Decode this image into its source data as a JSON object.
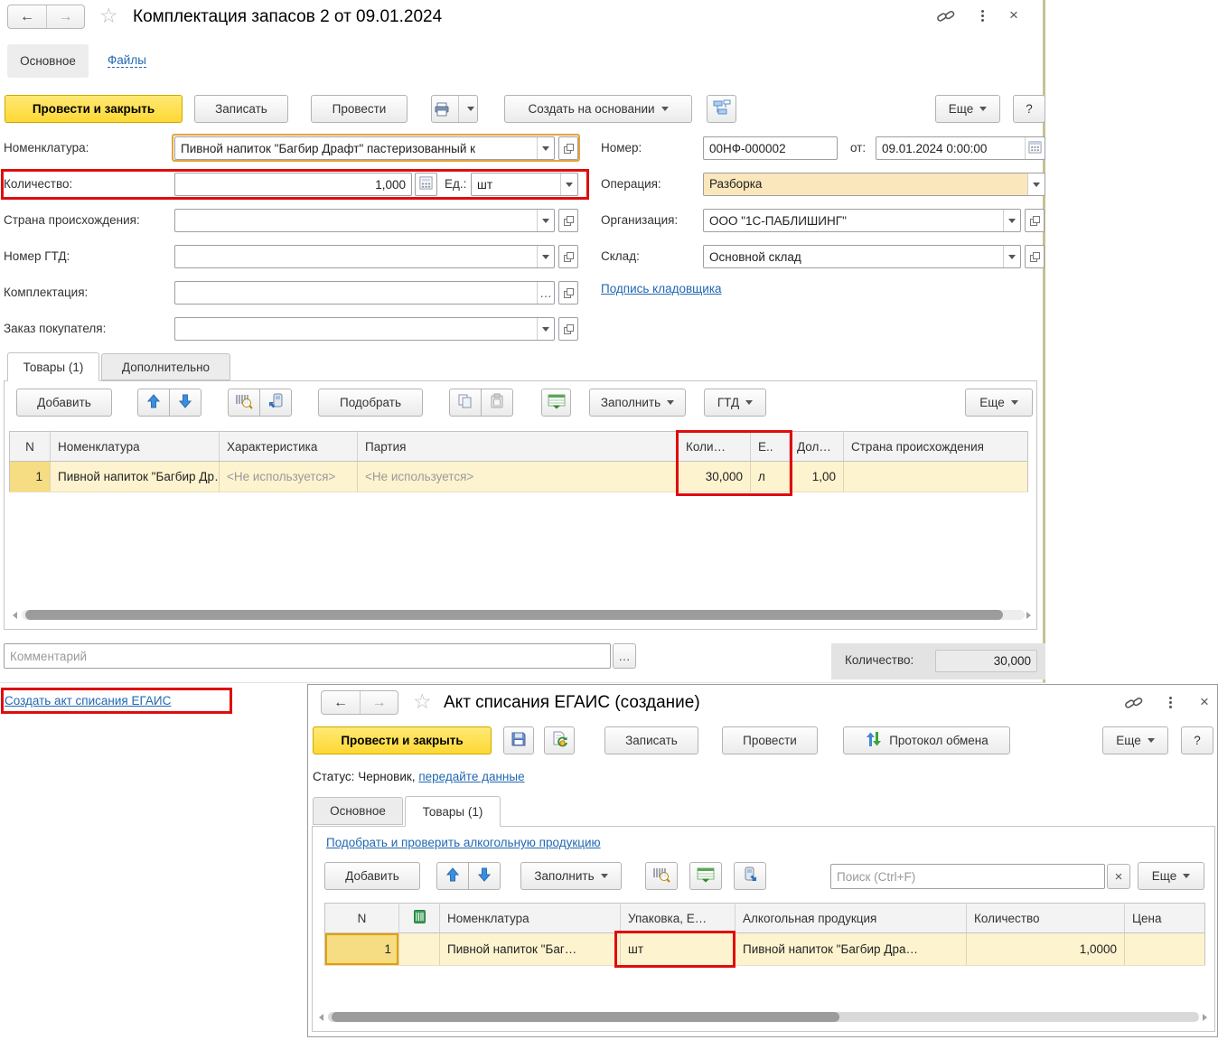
{
  "icons": {
    "back": "←",
    "forward": "→",
    "star": "☆",
    "close": "×",
    "ellipsis": "…"
  },
  "main_window": {
    "title": "Комплектация запасов 2 от 09.01.2024",
    "nav": {
      "main": "Основное",
      "files": "Файлы"
    },
    "toolbar": {
      "post_close": "Провести и закрыть",
      "write": "Записать",
      "post": "Провести",
      "create_based": "Создать на основании",
      "more": "Еще",
      "help": "?"
    },
    "form": {
      "nomenclature_label": "Номенклатура:",
      "nomenclature_value": "Пивной напиток \"Багбир Драфт\" пастеризованный к",
      "quantity_label": "Количество:",
      "quantity_value": "1,000",
      "unit_label": "Ед.:",
      "unit_value": "шт",
      "country_label": "Страна происхождения:",
      "gtd_label": "Номер ГТД:",
      "kit_label": "Комплектация:",
      "order_label": "Заказ покупателя:",
      "number_label": "Номер:",
      "number_value": "00НФ-000002",
      "date_label": "от:",
      "date_value": "09.01.2024  0:00:00",
      "operation_label": "Операция:",
      "operation_value": "Разборка",
      "org_label": "Организация:",
      "org_value": "ООО \"1С-ПАБЛИШИНГ\"",
      "warehouse_label": "Склад:",
      "warehouse_value": "Основной склад",
      "storekeeper_link": "Подпись кладовщика"
    },
    "tabs": {
      "goods": "Товары (1)",
      "additional": "Дополнительно"
    },
    "table_toolbar": {
      "add": "Добавить",
      "pick": "Подобрать",
      "fill": "Заполнить",
      "gtd": "ГТД",
      "more": "Еще"
    },
    "table": {
      "headers": [
        "N",
        "Номенклатура",
        "Характеристика",
        "Партия",
        "Коли…",
        "Е..",
        "Дол…",
        "Страна происхождения"
      ],
      "row": [
        "1",
        "Пивной напиток \"Багбир Др…",
        "<Не используется>",
        "<Не используется>",
        "30,000",
        "л",
        "1,00",
        ""
      ]
    },
    "footer": {
      "comment_placeholder": "Комментарий",
      "total_label": "Количество:",
      "total_value": "30,000"
    }
  },
  "create_act_link": "Создать акт списания ЕГАИС",
  "egais_window": {
    "title": "Акт списания ЕГАИС (создание)",
    "toolbar": {
      "post_close": "Провести и закрыть",
      "write": "Записать",
      "post": "Провести",
      "protocol": "Протокол обмена",
      "more": "Еще",
      "help": "?"
    },
    "status": {
      "label": "Статус:",
      "value": "Черновик,",
      "link": "передайте данные"
    },
    "tabs": {
      "main": "Основное",
      "goods": "Товары (1)"
    },
    "pick_link": "Подобрать и проверить алкогольную продукцию",
    "table_toolbar": {
      "add": "Добавить",
      "fill": "Заполнить",
      "search_placeholder": "Поиск (Ctrl+F)",
      "more": "Еще"
    },
    "table": {
      "headers": [
        "N",
        "Номенклатура",
        "Упаковка, Е…",
        "Алкогольная продукция",
        "Количество",
        "Цена"
      ],
      "row": [
        "1",
        "Пивной напиток \"Баг…",
        "шт",
        "Пивной напиток \"Багбир Дра…",
        "1,0000",
        ""
      ]
    }
  }
}
